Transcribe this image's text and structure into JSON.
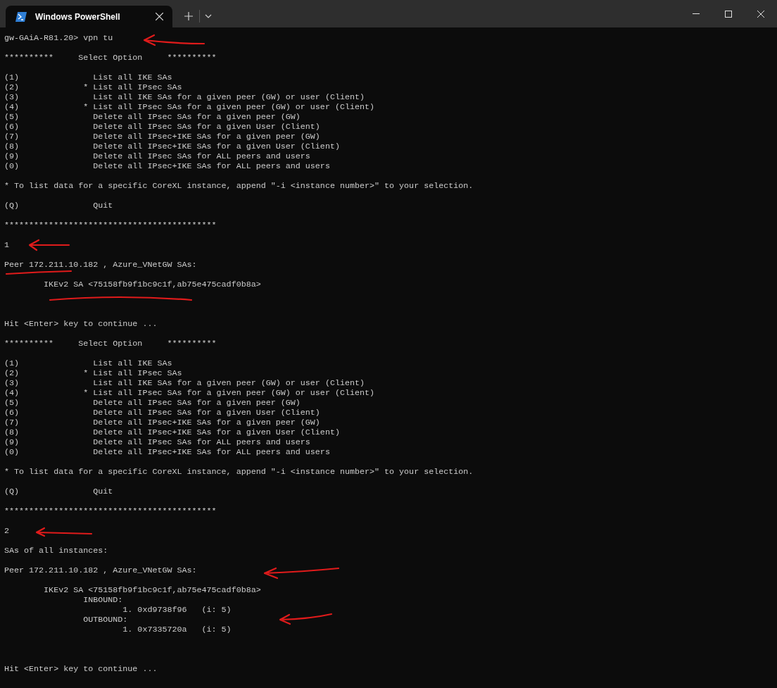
{
  "window": {
    "tabs": [
      {
        "title": "Windows PowerShell",
        "selected": true
      }
    ]
  },
  "terminal_lines": [
    {
      "kind": "text",
      "text": "gw-GAiA-R81.20> vpn tu"
    },
    {
      "kind": "blank"
    },
    {
      "kind": "text",
      "text": "**********     Select Option     **********"
    },
    {
      "kind": "blank"
    },
    {
      "kind": "text",
      "text": "(1)               List all IKE SAs"
    },
    {
      "kind": "text",
      "text": "(2)             * List all IPsec SAs"
    },
    {
      "kind": "text",
      "text": "(3)               List all IKE SAs for a given peer (GW) or user (Client)"
    },
    {
      "kind": "text",
      "text": "(4)             * List all IPsec SAs for a given peer (GW) or user (Client)"
    },
    {
      "kind": "text",
      "text": "(5)               Delete all IPsec SAs for a given peer (GW)"
    },
    {
      "kind": "text",
      "text": "(6)               Delete all IPsec SAs for a given User (Client)"
    },
    {
      "kind": "text",
      "text": "(7)               Delete all IPsec+IKE SAs for a given peer (GW)"
    },
    {
      "kind": "text",
      "text": "(8)               Delete all IPsec+IKE SAs for a given User (Client)"
    },
    {
      "kind": "text",
      "text": "(9)               Delete all IPsec SAs for ALL peers and users"
    },
    {
      "kind": "text",
      "text": "(0)               Delete all IPsec+IKE SAs for ALL peers and users"
    },
    {
      "kind": "blank"
    },
    {
      "kind": "text",
      "text": "* To list data for a specific CoreXL instance, append \"-i <instance number>\" to your selection."
    },
    {
      "kind": "blank"
    },
    {
      "kind": "text",
      "text": "(Q)               Quit"
    },
    {
      "kind": "blank"
    },
    {
      "kind": "text",
      "text": "*******************************************"
    },
    {
      "kind": "blank"
    },
    {
      "kind": "text",
      "text": "1"
    },
    {
      "kind": "blank"
    },
    {
      "kind": "text",
      "text": "Peer 172.211.10.182 , Azure_VNetGW SAs:"
    },
    {
      "kind": "blank"
    },
    {
      "kind": "text",
      "text": "        IKEv2 SA <75158fb9f1bc9c1f,ab75e475cadf0b8a>"
    },
    {
      "kind": "blank"
    },
    {
      "kind": "blank"
    },
    {
      "kind": "blank"
    },
    {
      "kind": "text",
      "text": "Hit <Enter> key to continue ..."
    },
    {
      "kind": "blank"
    },
    {
      "kind": "text",
      "text": "**********     Select Option     **********"
    },
    {
      "kind": "blank"
    },
    {
      "kind": "text",
      "text": "(1)               List all IKE SAs"
    },
    {
      "kind": "text",
      "text": "(2)             * List all IPsec SAs"
    },
    {
      "kind": "text",
      "text": "(3)               List all IKE SAs for a given peer (GW) or user (Client)"
    },
    {
      "kind": "text",
      "text": "(4)             * List all IPsec SAs for a given peer (GW) or user (Client)"
    },
    {
      "kind": "text",
      "text": "(5)               Delete all IPsec SAs for a given peer (GW)"
    },
    {
      "kind": "text",
      "text": "(6)               Delete all IPsec SAs for a given User (Client)"
    },
    {
      "kind": "text",
      "text": "(7)               Delete all IPsec+IKE SAs for a given peer (GW)"
    },
    {
      "kind": "text",
      "text": "(8)               Delete all IPsec+IKE SAs for a given User (Client)"
    },
    {
      "kind": "text",
      "text": "(9)               Delete all IPsec SAs for ALL peers and users"
    },
    {
      "kind": "text",
      "text": "(0)               Delete all IPsec+IKE SAs for ALL peers and users"
    },
    {
      "kind": "blank"
    },
    {
      "kind": "text",
      "text": "* To list data for a specific CoreXL instance, append \"-i <instance number>\" to your selection."
    },
    {
      "kind": "blank"
    },
    {
      "kind": "text",
      "text": "(Q)               Quit"
    },
    {
      "kind": "blank"
    },
    {
      "kind": "text",
      "text": "*******************************************"
    },
    {
      "kind": "blank"
    },
    {
      "kind": "text",
      "text": "2"
    },
    {
      "kind": "blank"
    },
    {
      "kind": "text",
      "text": "SAs of all instances:"
    },
    {
      "kind": "blank"
    },
    {
      "kind": "text",
      "text": "Peer 172.211.10.182 , Azure_VNetGW SAs:"
    },
    {
      "kind": "blank"
    },
    {
      "kind": "text",
      "text": "        IKEv2 SA <75158fb9f1bc9c1f,ab75e475cadf0b8a>"
    },
    {
      "kind": "text",
      "text": "                INBOUND:"
    },
    {
      "kind": "text",
      "text": "                        1. 0xd9738f96   (i: 5)"
    },
    {
      "kind": "text",
      "text": "                OUTBOUND:"
    },
    {
      "kind": "text",
      "text": "                        1. 0x7335720a   (i: 5)"
    },
    {
      "kind": "blank"
    },
    {
      "kind": "blank"
    },
    {
      "kind": "blank"
    },
    {
      "kind": "text",
      "text": "Hit <Enter> key to continue ..."
    }
  ]
}
